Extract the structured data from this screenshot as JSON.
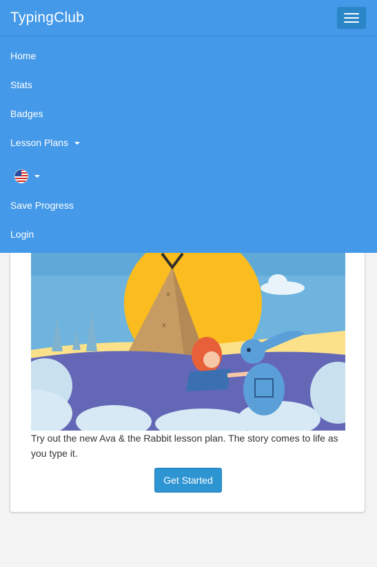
{
  "navbar": {
    "brand": "TypingClub",
    "menu_toggle_icon": "hamburger-icon",
    "items": [
      {
        "label": "Home"
      },
      {
        "label": "Stats"
      },
      {
        "label": "Badges"
      },
      {
        "label": "Lesson Plans",
        "has_dropdown": true
      },
      {
        "label": "",
        "icon": "us-flag-icon",
        "has_dropdown": true
      },
      {
        "label": "Save Progress"
      },
      {
        "label": "Login"
      }
    ]
  },
  "promo": {
    "image": "ava-and-rabbit-illustration",
    "text": "Try out the new Ava & the Rabbit lesson plan. The story comes to life as you type it.",
    "cta_label": "Get Started"
  },
  "colors": {
    "navbar_bg": "#4499e8",
    "toggle_bg": "#2a86c7",
    "cta_bg": "#2e95d3",
    "page_bg": "#f3f3f3"
  }
}
